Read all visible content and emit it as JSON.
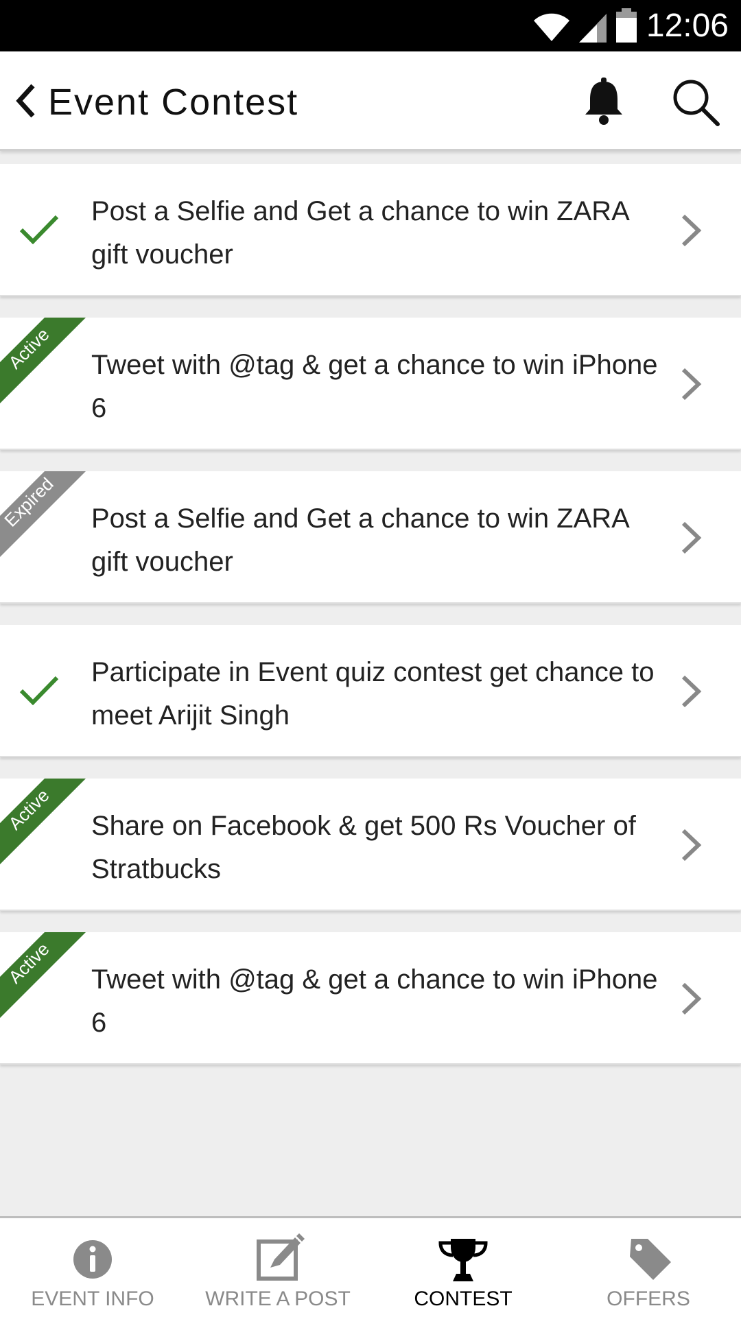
{
  "status_bar": {
    "time": "12:06",
    "icons": [
      "wifi-icon",
      "signal-icon",
      "battery-icon"
    ]
  },
  "header": {
    "back_icon": "back-chevron-icon",
    "title": "Event Contest",
    "notification_icon": "bell-icon",
    "search_icon": "search-icon"
  },
  "colors": {
    "active": "#3b7a2c",
    "expired": "#8c8c8c",
    "check": "#3a8a2e",
    "chevron": "#888888"
  },
  "contests": [
    {
      "text": "Post a Selfie and Get a chance to win ZARA gift voucher",
      "status": "completed",
      "badge": ""
    },
    {
      "text": "Tweet with @tag & get a chance to win iPhone 6",
      "status": "active",
      "badge": "Active"
    },
    {
      "text": "Post a Selfie and Get a chance to win ZARA gift voucher",
      "status": "expired",
      "badge": "Expired"
    },
    {
      "text": "Participate in Event quiz contest get chance to meet Arijit Singh",
      "status": "completed",
      "badge": ""
    },
    {
      "text": "Share on Facebook & get 500 Rs Voucher of Stratbucks",
      "status": "active",
      "badge": "Active"
    },
    {
      "text": "Tweet with @tag & get a chance to win iPhone 6",
      "status": "active",
      "badge": "Active"
    }
  ],
  "bottom_nav": {
    "items": [
      {
        "label": "EVENT INFO",
        "icon": "info-icon",
        "active": false
      },
      {
        "label": "WRITE A POST",
        "icon": "edit-icon",
        "active": false
      },
      {
        "label": "CONTEST",
        "icon": "trophy-icon",
        "active": true
      },
      {
        "label": "OFFERS",
        "icon": "tag-icon",
        "active": false
      }
    ]
  }
}
